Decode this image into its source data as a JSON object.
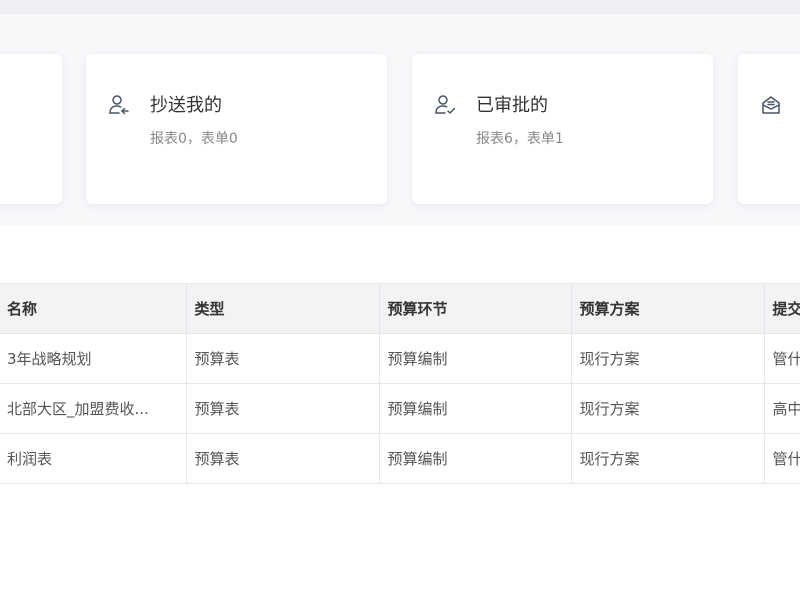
{
  "cards": [
    {
      "title": "",
      "subtitle": "",
      "icon": "partial-card"
    },
    {
      "title": "抄送我的",
      "subtitle": "报表0，表单0",
      "icon": "person-arrow-icon"
    },
    {
      "title": "已审批的",
      "subtitle": "报表6，表单1",
      "icon": "person-check-icon"
    },
    {
      "title": "",
      "subtitle": "",
      "icon": "inbox-icon"
    }
  ],
  "table": {
    "columns": [
      "名称",
      "类型",
      "预算环节",
      "预算方案",
      "提交"
    ],
    "rows": [
      [
        "3年战略规划",
        "预算表",
        "预算编制",
        "现行方案",
        "管什"
      ],
      [
        "北部大区_加盟费收...",
        "预算表",
        "预算编制",
        "现行方案",
        "高中"
      ],
      [
        "利润表",
        "预算表",
        "预算编制",
        "现行方案",
        "管什"
      ]
    ]
  },
  "colors": {
    "accent": "#4a6fa5",
    "header_bg": "#f2f3f5",
    "border": "#e4e6ea"
  }
}
